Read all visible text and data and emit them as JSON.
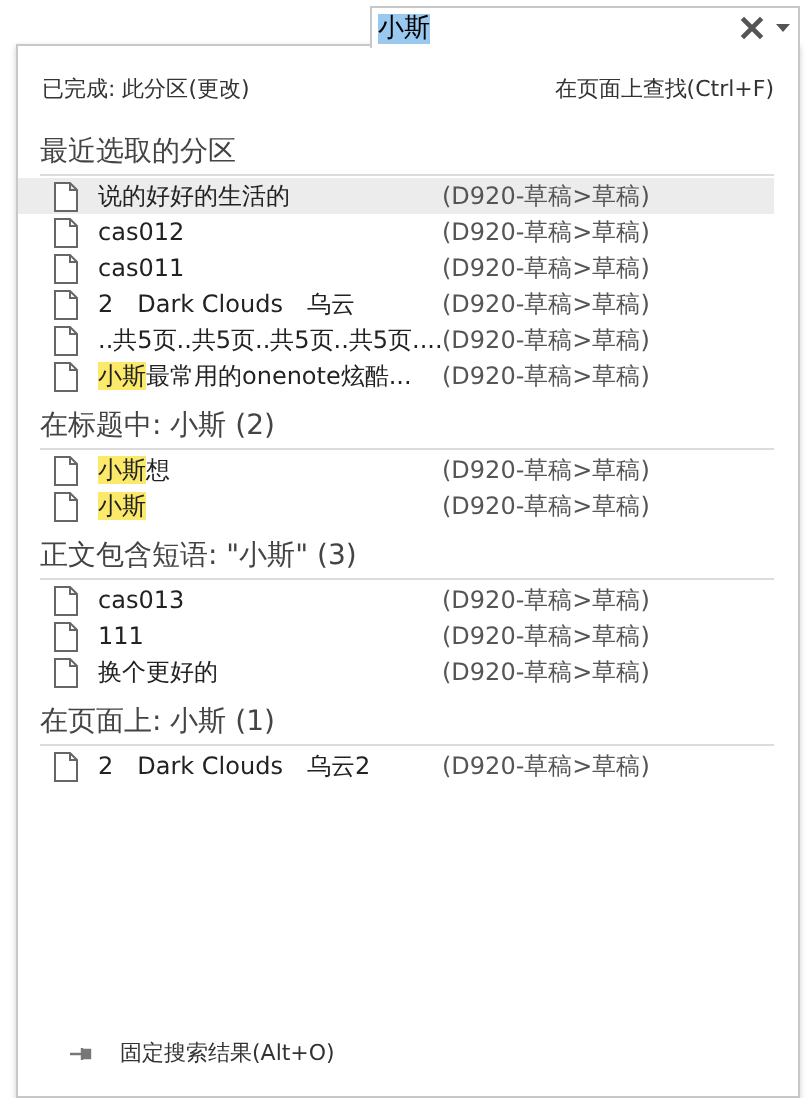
{
  "search": {
    "value": "小斯"
  },
  "status": {
    "scope": "已完成: 此分区(更改)",
    "find_on_page": "在页面上查找(Ctrl+F)"
  },
  "sections": [
    {
      "title": "最近选取的分区",
      "rows": [
        {
          "match": "",
          "title": "说的好好的生活的",
          "path": "(D920-草稿>草稿)",
          "selected": true
        },
        {
          "match": "",
          "title": "cas012",
          "path": "(D920-草稿>草稿)",
          "selected": false
        },
        {
          "match": "",
          "title": "cas011",
          "path": "(D920-草稿>草稿)",
          "selected": false
        },
        {
          "match": "",
          "title": "2　Dark Clouds　乌云",
          "path": "(D920-草稿>草稿)",
          "selected": false
        },
        {
          "match": "",
          "title": "..共5页..共5页..共5页..共5页....",
          "path": "(D920-草稿>草稿)",
          "selected": false
        },
        {
          "match": "小斯",
          "title": "最常用的onenote炫酷...",
          "path": "(D920-草稿>草稿)",
          "selected": false
        }
      ]
    },
    {
      "title": "在标题中: 小斯 (2)",
      "rows": [
        {
          "match": "小斯",
          "title": "想",
          "path": "(D920-草稿>草稿)",
          "selected": false
        },
        {
          "match": "小斯",
          "title": "",
          "path": "(D920-草稿>草稿)",
          "selected": false
        }
      ]
    },
    {
      "title": "正文包含短语: \"小斯\" (3)",
      "rows": [
        {
          "match": "",
          "title": "cas013",
          "path": "(D920-草稿>草稿)",
          "selected": false
        },
        {
          "match": "",
          "title": "111",
          "path": "(D920-草稿>草稿)",
          "selected": false
        },
        {
          "match": "",
          "title": "换个更好的",
          "path": "(D920-草稿>草稿)",
          "selected": false
        }
      ]
    },
    {
      "title": "在页面上: 小斯 (1)",
      "rows": [
        {
          "match": "",
          "title": "2　Dark Clouds　乌云2",
          "path": "(D920-草稿>草稿)",
          "selected": false
        }
      ]
    }
  ],
  "footer": {
    "pin_label": "固定搜索结果(Alt+O)"
  }
}
